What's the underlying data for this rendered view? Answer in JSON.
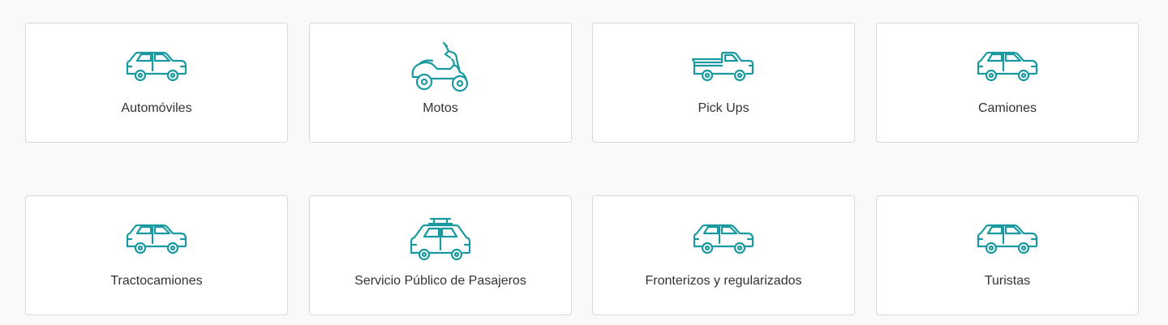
{
  "accent_color": "#1a9aa0",
  "cards": [
    {
      "label": "Automóviles",
      "icon": "car-icon"
    },
    {
      "label": "Motos",
      "icon": "scooter-icon"
    },
    {
      "label": "Pick Ups",
      "icon": "pickup-truck-icon"
    },
    {
      "label": "Camiones",
      "icon": "car-icon"
    },
    {
      "label": "Tractocamiones",
      "icon": "car-icon"
    },
    {
      "label": "Servicio Público de Pasajeros",
      "icon": "taxi-icon"
    },
    {
      "label": "Fronterizos y regularizados",
      "icon": "car-icon"
    },
    {
      "label": "Turistas",
      "icon": "car-icon"
    }
  ]
}
